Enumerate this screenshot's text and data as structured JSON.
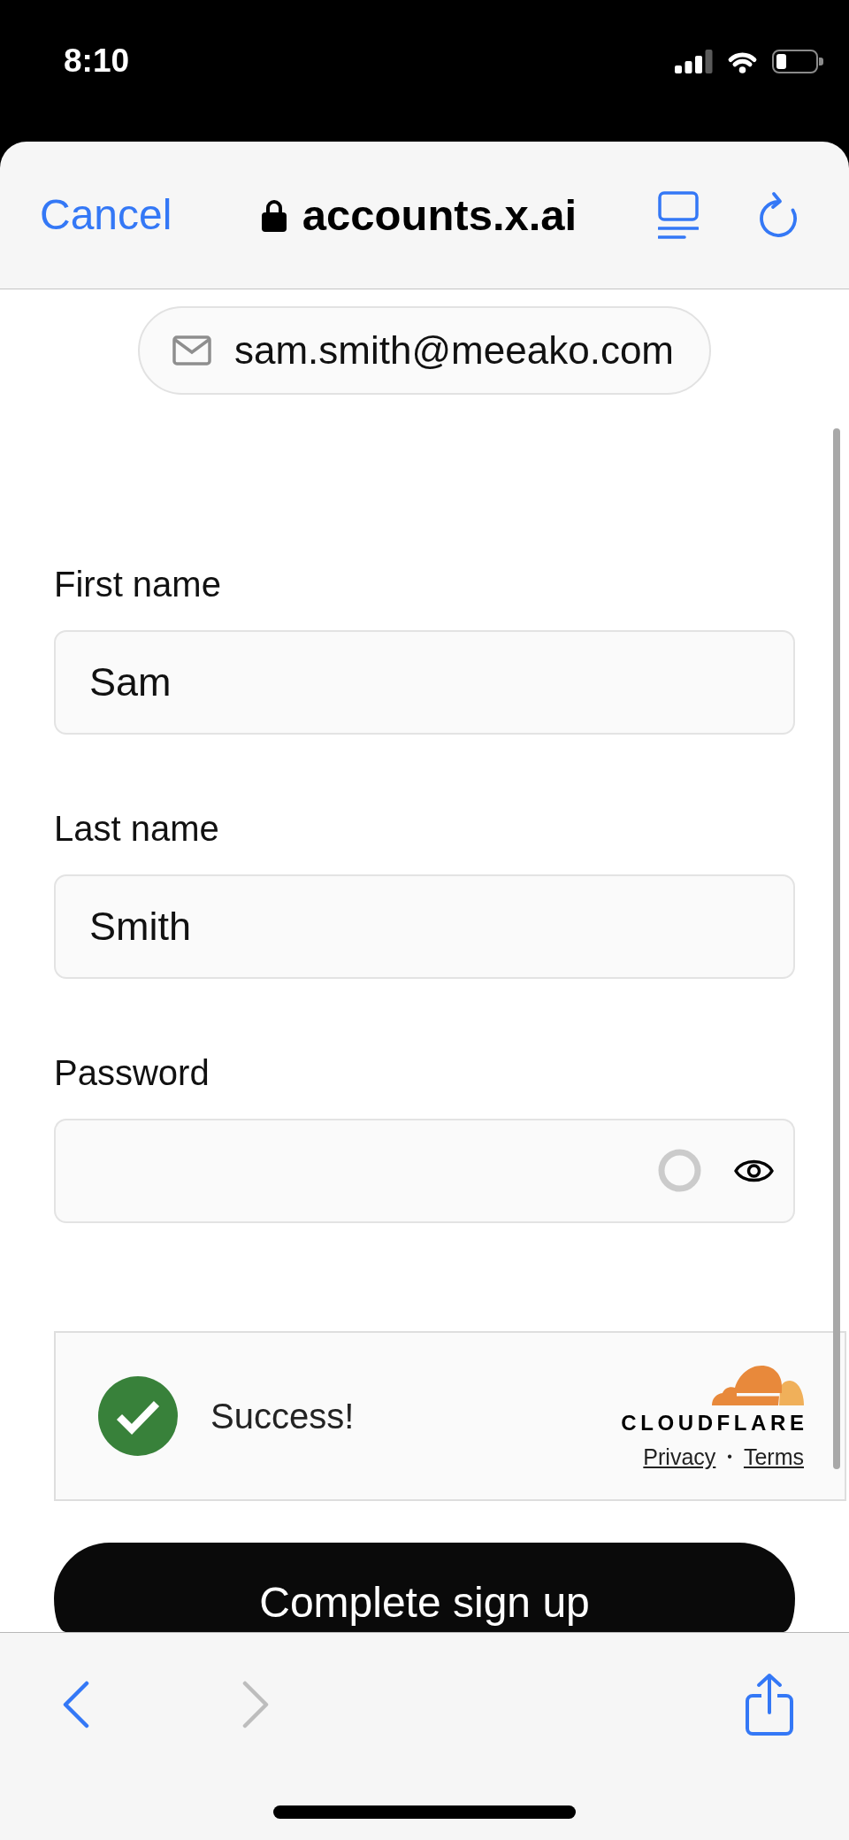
{
  "status_bar": {
    "time": "8:10"
  },
  "header": {
    "cancel_label": "Cancel",
    "url": "accounts.x.ai",
    "secure": true
  },
  "email_chip": {
    "email": "sam.smith@meeako.com"
  },
  "fields": [
    {
      "kind": "text",
      "label": "First name",
      "value": "Sam"
    },
    {
      "kind": "text",
      "label": "Last name",
      "value": "Smith"
    },
    {
      "kind": "password",
      "label": "Password"
    }
  ],
  "captcha": {
    "verified": true,
    "status": "Success!",
    "brand": "CLOUDFLARE",
    "links": [
      "Privacy",
      "Terms"
    ],
    "separator": "•"
  },
  "submit_button": {
    "label": "Complete sign up"
  },
  "toolbar": {
    "buttons": [
      {
        "kind": "back",
        "disabled": false
      },
      {
        "kind": "forward",
        "disabled": true
      },
      {
        "kind": "share",
        "disabled": false
      }
    ]
  }
}
